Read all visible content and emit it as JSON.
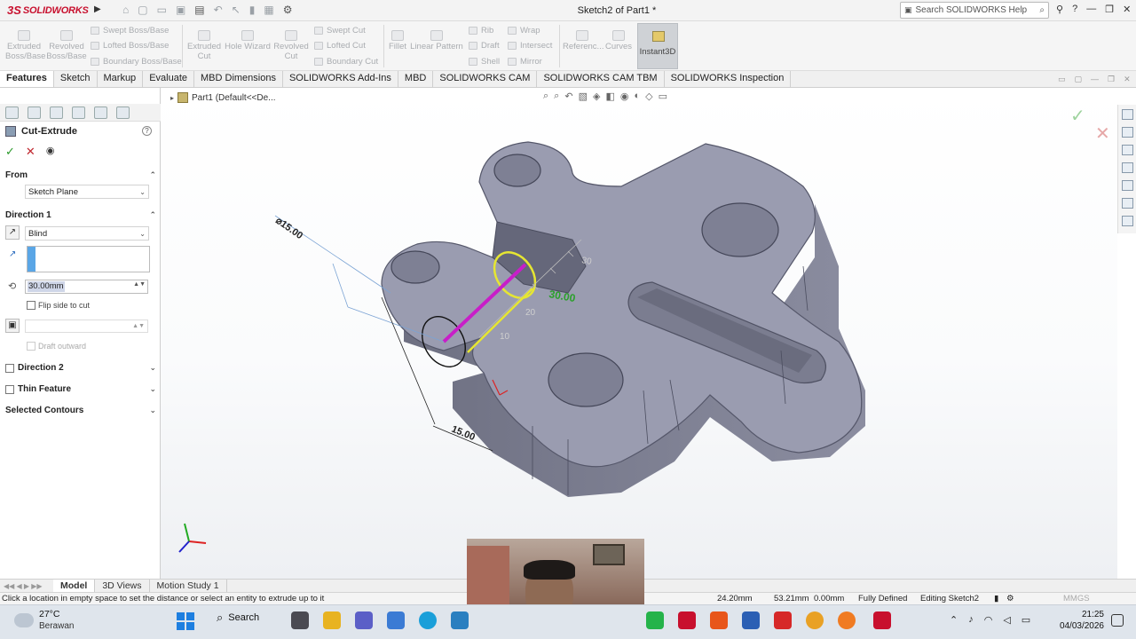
{
  "app": {
    "brand": "SOLIDWORKS",
    "document_title": "Sketch2 of Part1 *",
    "help_search_placeholder": "Search SOLIDWORKS Help"
  },
  "command_manager": {
    "extruded_boss": "Extruded Boss/Base",
    "revolved_boss": "Revolved Boss/Base",
    "swept_boss": "Swept Boss/Base",
    "lofted_boss": "Lofted Boss/Base",
    "boundary_boss": "Boundary Boss/Base",
    "extruded_cut": "Extruded Cut",
    "hole_wizard": "Hole Wizard",
    "revolved_cut": "Revolved Cut",
    "swept_cut": "Swept Cut",
    "lofted_cut": "Lofted Cut",
    "boundary_cut": "Boundary Cut",
    "fillet": "Fillet",
    "linear_pattern": "Linear Pattern",
    "rib": "Rib",
    "draft": "Draft",
    "shell": "Shell",
    "wrap": "Wrap",
    "intersect": "Intersect",
    "mirror": "Mirror",
    "reference": "Referenc...",
    "curves": "Curves",
    "instant3d": "Instant3D"
  },
  "tabs": [
    "Features",
    "Sketch",
    "Markup",
    "Evaluate",
    "MBD Dimensions",
    "SOLIDWORKS Add-Ins",
    "MBD",
    "SOLIDWORKS CAM",
    "SOLIDWORKS CAM TBM",
    "SOLIDWORKS Inspection"
  ],
  "property_manager": {
    "title": "Cut-Extrude",
    "from_label": "From",
    "from_value": "Sketch Plane",
    "direction1_label": "Direction 1",
    "end_condition": "Blind",
    "depth_value": "30.00mm",
    "flip_side": "Flip side to cut",
    "draft_outward": "Draft outward",
    "direction2_label": "Direction 2",
    "thin_feature_label": "Thin Feature",
    "selected_contours_label": "Selected Contours"
  },
  "graphics": {
    "breadcrumb": "Part1  (Default<<De...",
    "dim_diameter": "⌀15.00",
    "dim_depth": "30.00",
    "dim_15": "15.00",
    "ruler_20": "20",
    "ruler_10": "10",
    "ruler_30": "30"
  },
  "bottom_tabs": [
    "Model",
    "3D Views",
    "Motion Study 1"
  ],
  "status": {
    "message": "Click a location in empty space to set the distance or select an entity to extrude up to it",
    "x": "24.20mm",
    "y": "53.21mm",
    "z": "0.00mm",
    "state": "Fully Defined",
    "editing": "Editing Sketch2",
    "units": "MMGS"
  },
  "taskbar": {
    "temperature": "27°C",
    "weather": "Berawan",
    "search": "Search",
    "time": "21:25",
    "date": "04/03/2026"
  },
  "colors": {
    "brand_red": "#c8102e",
    "model_face": "#9a9cb0",
    "preview_magenta": "#c81ec8",
    "preview_yellow": "#e6e632",
    "dim_green": "#2aa02a"
  }
}
